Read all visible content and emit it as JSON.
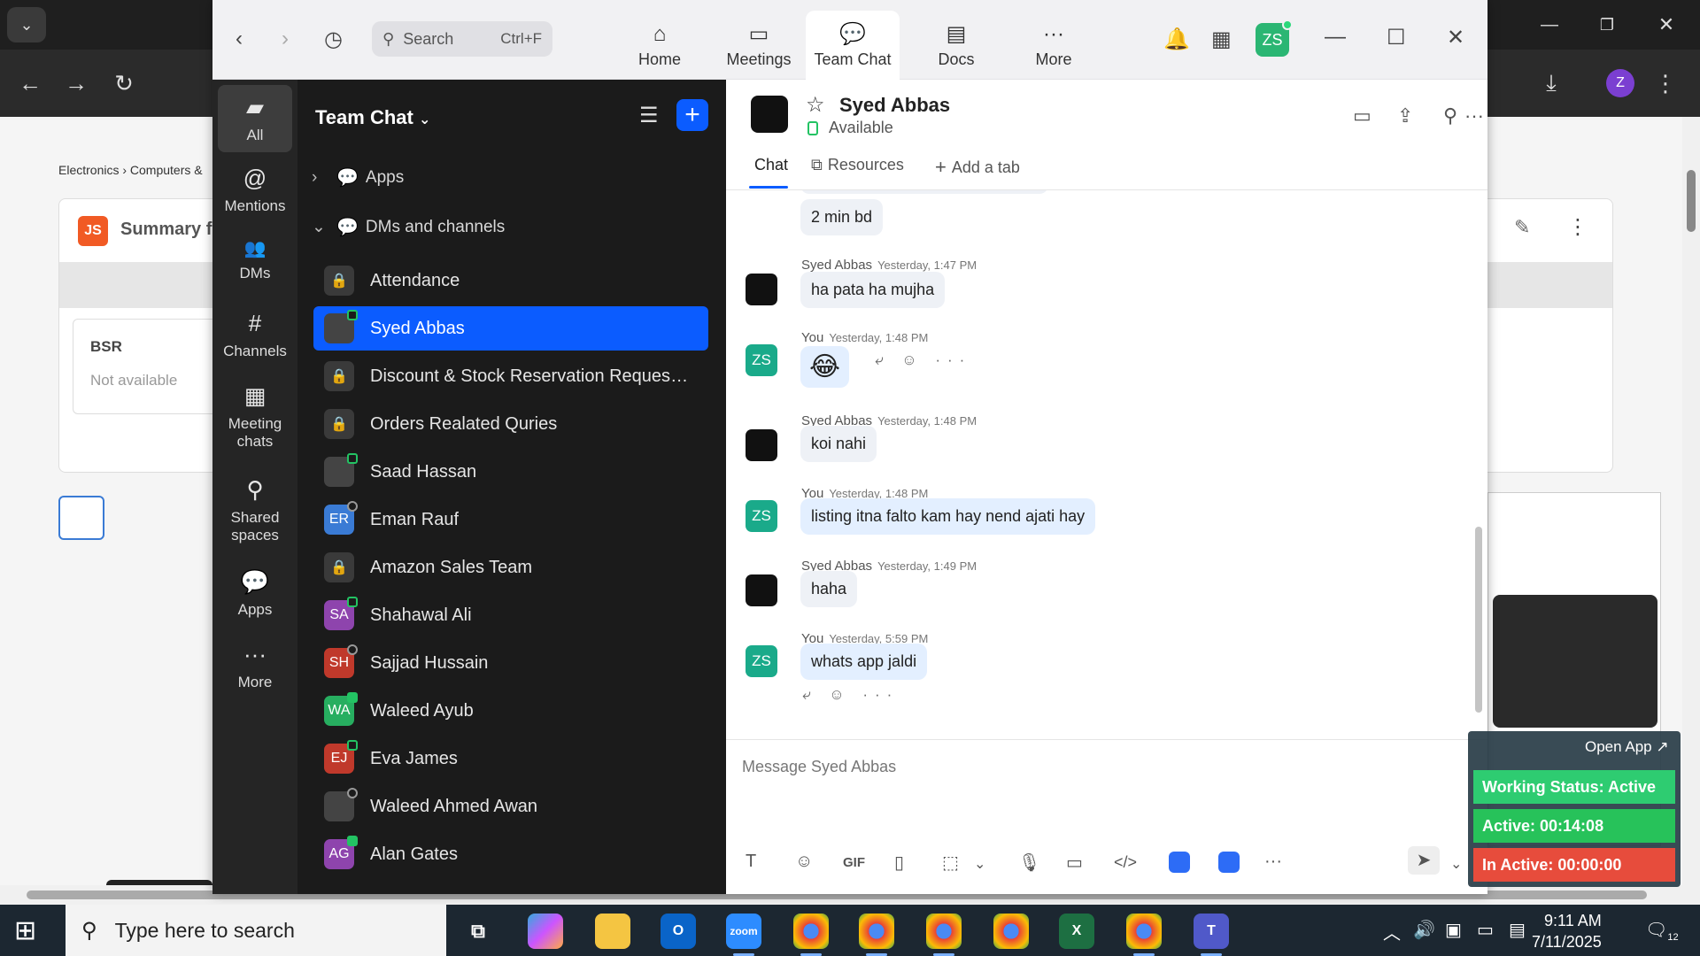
{
  "browser": {
    "breadcrumb": "Electronics › Computers &",
    "card_title": "Summary fo",
    "bsr_label": "BSR",
    "bsr_value": "Not available",
    "profile_initial": "Z"
  },
  "zoom": {
    "search_placeholder": "Search",
    "search_shortcut": "Ctrl+F",
    "nav_tabs": [
      {
        "label": "Home",
        "icon": "⌂"
      },
      {
        "label": "Meetings",
        "icon": "▭"
      },
      {
        "label": "Team Chat",
        "icon": "💬"
      },
      {
        "label": "Docs",
        "icon": "▤"
      },
      {
        "label": "More",
        "icon": "···"
      }
    ],
    "user_initials": "ZS"
  },
  "rail": [
    {
      "label": "All",
      "icon": "▰"
    },
    {
      "label": "Mentions",
      "icon": "@"
    },
    {
      "label": "DMs",
      "icon": "👥"
    },
    {
      "label": "Channels",
      "icon": "#"
    },
    {
      "label": "Meeting chats",
      "icon": "▦"
    },
    {
      "label": "Shared spaces",
      "icon": "⚲"
    },
    {
      "label": "Apps",
      "icon": "💬"
    },
    {
      "label": "More",
      "icon": "···"
    }
  ],
  "sidebar": {
    "title": "Team Chat",
    "section_apps": "Apps",
    "section_dms": "DMs and channels",
    "items": [
      {
        "name": "Attendance",
        "kind": "lock"
      },
      {
        "name": "Syed Abbas",
        "kind": "photo",
        "selected": true
      },
      {
        "name": "Discount & Stock Reservation Requests ...",
        "kind": "lock"
      },
      {
        "name": "Orders Realated Quries",
        "kind": "lock"
      },
      {
        "name": "Saad Hassan",
        "kind": "photo"
      },
      {
        "name": "Eman Rauf",
        "kind": "initials",
        "initials": "ER",
        "color": "#3a7bd5"
      },
      {
        "name": "Amazon Sales Team",
        "kind": "lock"
      },
      {
        "name": "Shahawal Ali",
        "kind": "initials",
        "initials": "SA",
        "color": "#8e44ad"
      },
      {
        "name": "Sajjad Hussain",
        "kind": "initials",
        "initials": "SH",
        "color": "#c0392b"
      },
      {
        "name": "Waleed Ayub",
        "kind": "initials",
        "initials": "WA",
        "color": "#27ae60"
      },
      {
        "name": "Eva James",
        "kind": "initials",
        "initials": "EJ",
        "color": "#c0392b"
      },
      {
        "name": "Waleed Ahmed Awan",
        "kind": "photo"
      },
      {
        "name": "Alan Gates",
        "kind": "initials",
        "initials": "AG",
        "color": "#8e44ad"
      }
    ]
  },
  "chat": {
    "contact_name": "Syed Abbas",
    "status": "Available",
    "tabs": [
      "Chat",
      "Resources",
      "Add a tab"
    ],
    "messages": [
      {
        "sender": "",
        "time": "",
        "text": "2 min bd",
        "me": false
      },
      {
        "sender": "Syed Abbas",
        "time": "Yesterday, 1:47 PM",
        "text": "ha pata ha mujha",
        "me": false
      },
      {
        "sender": "You",
        "time": "Yesterday, 1:48 PM",
        "text": "😂",
        "me": true
      },
      {
        "sender": "Syed Abbas",
        "time": "Yesterday, 1:48 PM",
        "text": "koi nahi",
        "me": false
      },
      {
        "sender": "You",
        "time": "Yesterday, 1:48 PM",
        "text": "listing itna falto kam hay nend ajati hay",
        "me": true
      },
      {
        "sender": "Syed Abbas",
        "time": "Yesterday, 1:49 PM",
        "text": "haha",
        "me": false
      },
      {
        "sender": "You",
        "time": "Yesterday, 5:59 PM",
        "text": "whats app jaldi",
        "me": true
      }
    ],
    "my_initials": "ZS",
    "composer_placeholder": "Message Syed Abbas",
    "gif_label": "GIF"
  },
  "widget": {
    "open_app": "Open App ↗",
    "working_status": "Working Status: Active",
    "active": "Active: 00:14:08",
    "inactive": "In Active: 00:00:00",
    "colors": {
      "working": "#2ecc71",
      "active": "#27c25a",
      "inactive": "#e74c3c"
    }
  },
  "taskbar": {
    "search_placeholder": "Type here to search",
    "time": "9:11 AM",
    "date": "7/11/2025",
    "notif_count": "12",
    "zoom_label": "zoom"
  }
}
